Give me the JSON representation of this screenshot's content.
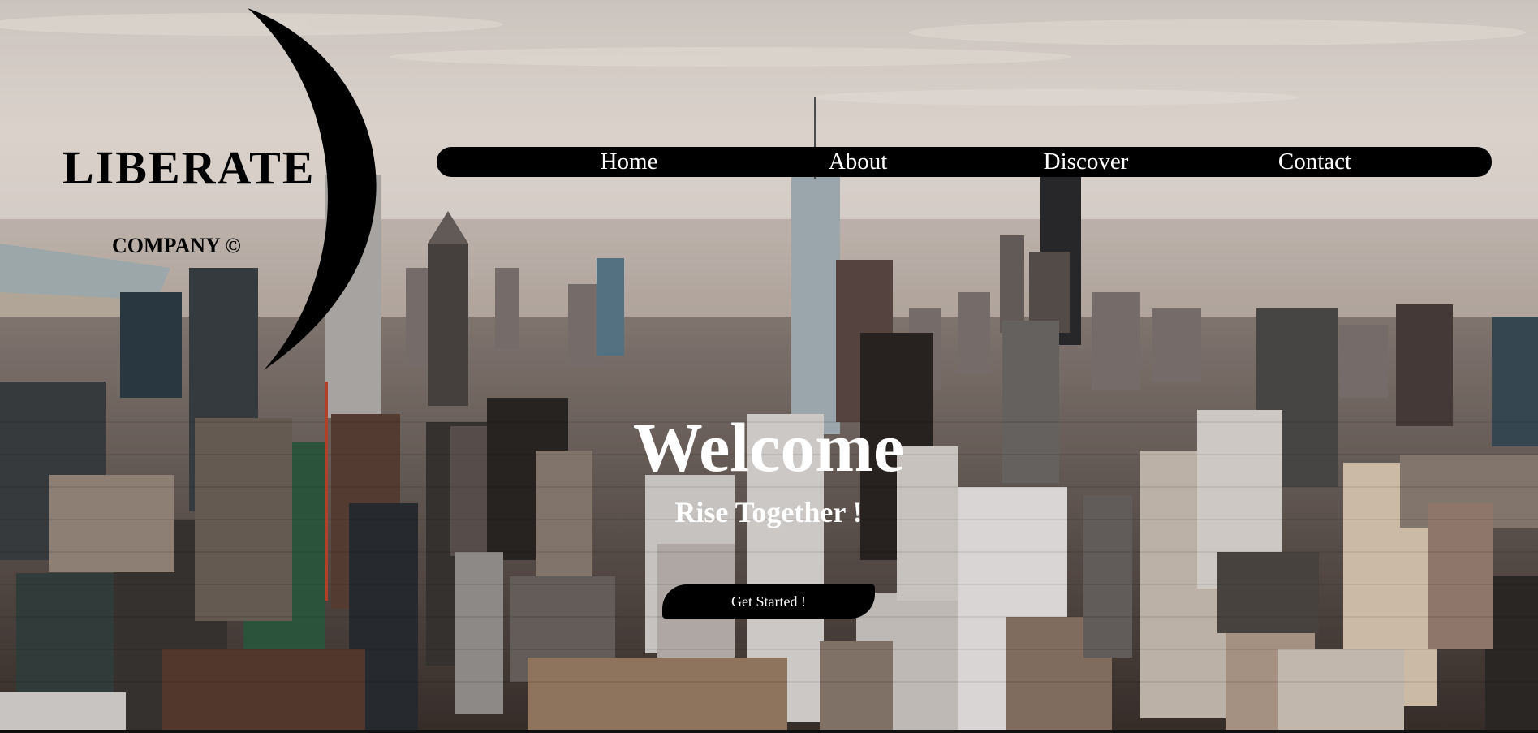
{
  "brand": {
    "name": "LIBERATE",
    "subtitle": "COMPANY ©"
  },
  "nav": {
    "items": [
      {
        "label": "Home"
      },
      {
        "label": "About"
      },
      {
        "label": "Discover"
      },
      {
        "label": "Contact"
      }
    ]
  },
  "hero": {
    "title": "Welcome",
    "subtitle": "Rise Together !",
    "cta_label": "Get Started !"
  },
  "colors": {
    "nav_background": "#000000",
    "text_light": "#ffffff",
    "brand_text": "#000000",
    "sky": "#e9e0d8"
  },
  "icons": {
    "logo": "crescent-moon-icon"
  }
}
